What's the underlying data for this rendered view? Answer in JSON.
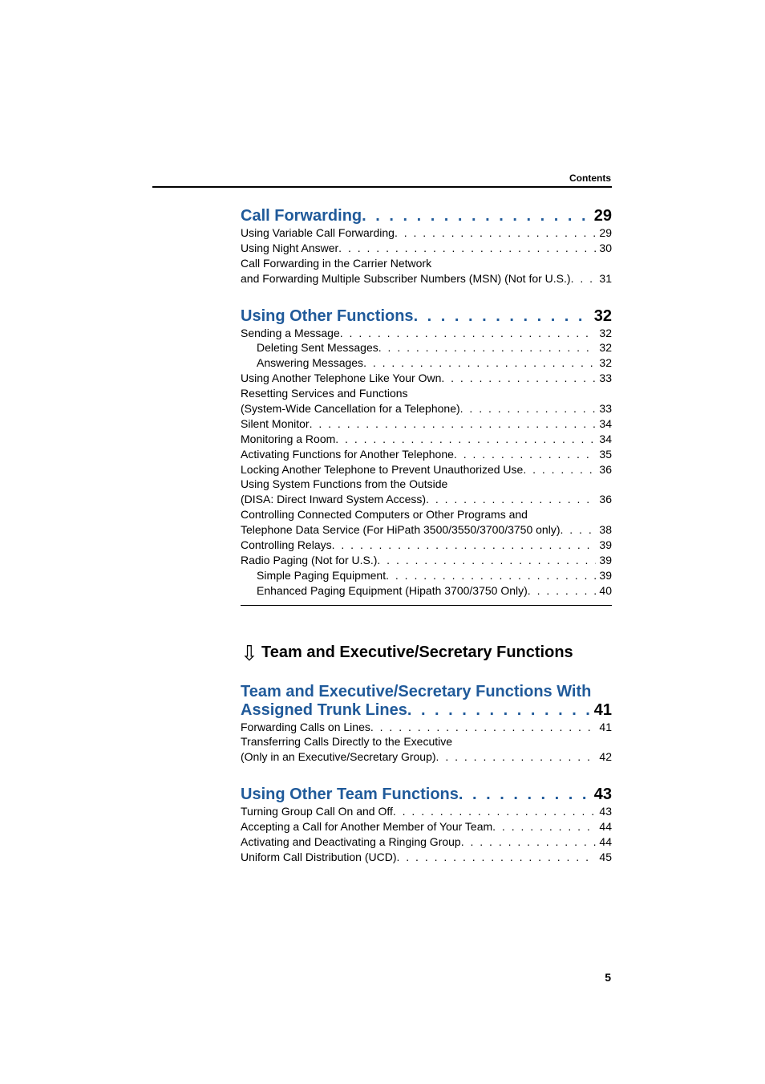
{
  "header": {
    "label": "Contents"
  },
  "page_number": "5",
  "leader_section": ". . . . . . . . . . . . . . . . . . . . . . . . . . . . . . . . . . . . . . . . . . . . . . . . . . . . . . . . . . . . . . . . . . . . . . . . . . . . . . . . . . . . . . . . . . . . . . . .",
  "leader": ". . . . . . . . . . . . . . . . . . . . . . . . . . . . . . . . . . . . . . . . . . . . . . . . . . . . . . . . . . . . . . . . . . . . . . . . . . . . . . . . . . . . . . . . . . . . . . . . . . . . . . . . . . . . . . . . . . . . . . . . . . . . . . . . . . . .",
  "sections": {
    "call_forwarding": {
      "title": "Call Forwarding",
      "page": "29",
      "items": [
        {
          "title": "Using Variable Call Forwarding",
          "page": "29",
          "indent": 0
        },
        {
          "title": "Using Night Answer",
          "page": "30",
          "indent": 0
        },
        {
          "title_line1": "Call Forwarding in the Carrier Network",
          "title_line2": "and Forwarding Multiple Subscriber Numbers (MSN) (Not for U.S.)",
          "page": "31",
          "indent": 0,
          "multi": true
        }
      ]
    },
    "other_functions": {
      "title": "Using Other Functions",
      "page": "32",
      "items": [
        {
          "title": "Sending a Message",
          "page": "32",
          "indent": 0
        },
        {
          "title": "Deleting Sent Messages",
          "page": "32",
          "indent": 1
        },
        {
          "title": "Answering Messages",
          "page": "32",
          "indent": 1
        },
        {
          "title": "Using Another Telephone Like Your Own",
          "page": "33",
          "indent": 0
        },
        {
          "title_line1": "Resetting Services and Functions",
          "title_line2": "(System-Wide Cancellation for a Telephone)",
          "page": "33",
          "indent": 0,
          "multi": true
        },
        {
          "title": "Silent Monitor",
          "page": "34",
          "indent": 0
        },
        {
          "title": "Monitoring a Room",
          "page": "34",
          "indent": 0
        },
        {
          "title": "Activating Functions for Another Telephone",
          "page": "35",
          "indent": 0
        },
        {
          "title": "Locking Another Telephone to Prevent Unauthorized Use",
          "page": "36",
          "indent": 0
        },
        {
          "title_line1": "Using System Functions from the Outside",
          "title_line2": "(DISA: Direct Inward System Access)",
          "page": "36",
          "indent": 0,
          "multi": true
        },
        {
          "title_line1": "Controlling Connected Computers or Other Programs and",
          "title_line2": "Telephone Data Service (For HiPath 3500/3550/3700/3750 only)",
          "page": "38",
          "indent": 0,
          "multi": true
        },
        {
          "title": "Controlling Relays",
          "page": "39",
          "indent": 0
        },
        {
          "title": "Radio Paging (Not for U.S.)",
          "page": "39",
          "indent": 0
        },
        {
          "title": "Simple Paging Equipment",
          "page": "39",
          "indent": 1
        },
        {
          "title": "Enhanced Paging Equipment (Hipath 3700/3750 Only)",
          "page": "40",
          "indent": 1
        }
      ]
    },
    "chapter": {
      "icon": "⇩",
      "title": "Team and Executive/Secretary Functions"
    },
    "team_exec": {
      "title_line1": "Team and Executive/Secretary Functions With",
      "title_line2": "Assigned Trunk Lines",
      "page": "41",
      "items": [
        {
          "title": "Forwarding Calls on Lines",
          "page": "41",
          "indent": 0
        },
        {
          "title_line1": "Transferring Calls Directly to the Executive",
          "title_line2": "(Only in an Executive/Secretary Group)",
          "page": "42",
          "indent": 0,
          "multi": true
        }
      ]
    },
    "other_team": {
      "title": "Using Other Team Functions",
      "page": "43",
      "items": [
        {
          "title": "Turning Group Call On and Off",
          "page": "43",
          "indent": 0
        },
        {
          "title": "Accepting a Call for Another Member of Your Team",
          "page": "44",
          "indent": 0
        },
        {
          "title": "Activating and Deactivating a Ringing Group",
          "page": "44",
          "indent": 0
        },
        {
          "title": "Uniform Call Distribution (UCD)",
          "page": "45",
          "indent": 0
        }
      ]
    }
  }
}
